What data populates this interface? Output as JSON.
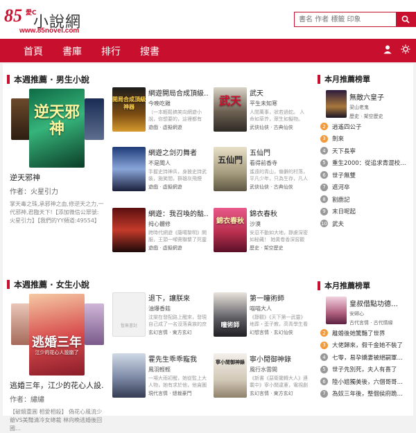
{
  "logo": {
    "number": "85",
    "ai": "愛C",
    "name": "小說網",
    "url": "www.85novel.com"
  },
  "search": {
    "placeholder": "書名 作者 標籤 印象"
  },
  "nav": [
    "首頁",
    "書庫",
    "排行",
    "搜書"
  ],
  "male": {
    "heading": "本週推薦 · 男生小說",
    "feature": {
      "cover_text": "逆天邪神",
      "title": "逆天邪神",
      "author": "作者：火星引力",
      "desc": "掌天毒之珠,承邪神之血,修逆天之力,一代邪神,君臨天下!【添加微信公眾號:火星引力】【我們的YY頻道:49554】"
    },
    "books": [
      {
        "title": "網遊開局合成頂級…",
        "author": "今晚吃雞",
        "desc": "（一本輕鬆搞笑向網遊小說，你想要的，這裡都有哦）江白只想打金，開…",
        "genre": "遊戲 · 虛擬網遊",
        "cover": "開局合成頂級神器"
      },
      {
        "title": "武天",
        "author": "平生未知寒",
        "desc": "人間萬事，狀若過蛇。 人命如草芥，眾生如擬物。 \"誰會知道這一變了…",
        "genre": "武俠仙俠 · 古典仙俠",
        "cover": "武天"
      },
      {
        "title": "網遊之剑刃舞者",
        "author": "不是聞人",
        "desc": "手握史詩神兵，身披史詩武裝，施笑間，群雄灰飛煙滅，這是一部群合激…",
        "genre": "遊戲 · 虛擬網遊",
        "cover": ""
      },
      {
        "title": "五仙門",
        "author": "看得前香寺",
        "desc": "遙遠的青山，偏僻的村落，平凡少年，只為生存，凡人生活卻在修仙之路，有逢…",
        "genre": "武俠仙俠 · 古典仙俠",
        "cover": "五仙門"
      },
      {
        "title": "網遊：我召喚的骷…",
        "author": "拇心體修",
        "desc": "跨時代網遊《薩噶黎明》開服，王頭一噸需聯繫了死靈法師能個成秀穆業，用了發...",
        "genre": "遊戲 · 虛擬網遊",
        "cover": ""
      },
      {
        "title": "錦衣春秋",
        "author": "沙漠",
        "desc": "安忍不動如大地，靜慮深密如秘藏！ 她黃卷香深窖觀田，萬金萬籟萬網嘩天地，向…",
        "genre": "歷史 · 架空歷史",
        "cover": "錦衣春秋"
      }
    ],
    "rank": {
      "heading": "本月推薦榜單",
      "top": {
        "title": "無敵六皇子",
        "author": "梁山老鬼",
        "genre": "歷史 · 架空歷史"
      },
      "items": [
        "逍遙四公子",
        "劍來",
        "天下長寧",
        "重生2000：從追求青澀校…",
        "世子無雙",
        "遮河卒",
        "割鹿記",
        "末日呢起",
        "武夫"
      ]
    }
  },
  "female": {
    "heading": "本週推薦 · 女生小說",
    "feature": {
      "cover_text": "逃婚三年",
      "cover_sub": "江少的花心人設崩了",
      "title": "逃婚三年，江少的花心人設…",
      "author": "作者：繡繡",
      "desc": "【破鏡重圓 相愛相殺】 偽花心風流少爺VS美豔清冷女總裁 林向晚逃婚後回國…"
    },
    "books": [
      {
        "title": "退下，讓朕來",
        "author": "油爆香菇",
        "desc": "沈棠在發配路上醒來，發現自己成了一名沒落貴族的庶女，天塌神石，西國相爭，文鎮…",
        "genre": "玄幻言情 · 東方玄幻",
        "cover": "暫無書封"
      },
      {
        "title": "第一瞳術師",
        "author": "喵喵大人",
        "desc": "《靜觀》《天下第一武靈》地葬・歪子教，高青學生看的玄幻群傳文，靈擊，是…",
        "genre": "幻想言情 · 玄幻仙俠",
        "cover": "瞳術師"
      },
      {
        "title": "霍先生乖乖寵我",
        "author": "鳳羽輕輕",
        "desc": "一場大雨初醒，她從監上大人物，她有求於他，他貪圖她年輕漂亮的好，兩情相悅…",
        "genre": "現代言情 · 總裁豪門",
        "cover": ""
      },
      {
        "title": "寧小閒御神錄",
        "author": "風行水雲間",
        "desc": "《新書《惡衛擺轉大人》連載中》寧小閒違憲，電視劇和遊戲改編ing，發感動…",
        "genre": "玄幻言情 · 東方玄幻",
        "cover": "寧小閒御神錄"
      }
    ],
    "rank": {
      "heading": "本月推薦榜單",
      "top": {
        "title": "皇叔借點功德…",
        "author": "安卿心",
        "genre": "古代言情 · 古代情緣"
      },
      "items": [
        "離婚後她驚豔了世界",
        "大佬歸來，假千金她不裝了",
        "七零，易孕嬌妻被絕嗣軍…",
        "世子先別死，夫人有喜了",
        "陸小姐獨美後，六個哥哥…",
        "為奴三年後，整個侯府跪…"
      ]
    }
  },
  "colors": {
    "accent": "#c8102e",
    "hot": "#f39a3c",
    "muted": "#999999"
  }
}
